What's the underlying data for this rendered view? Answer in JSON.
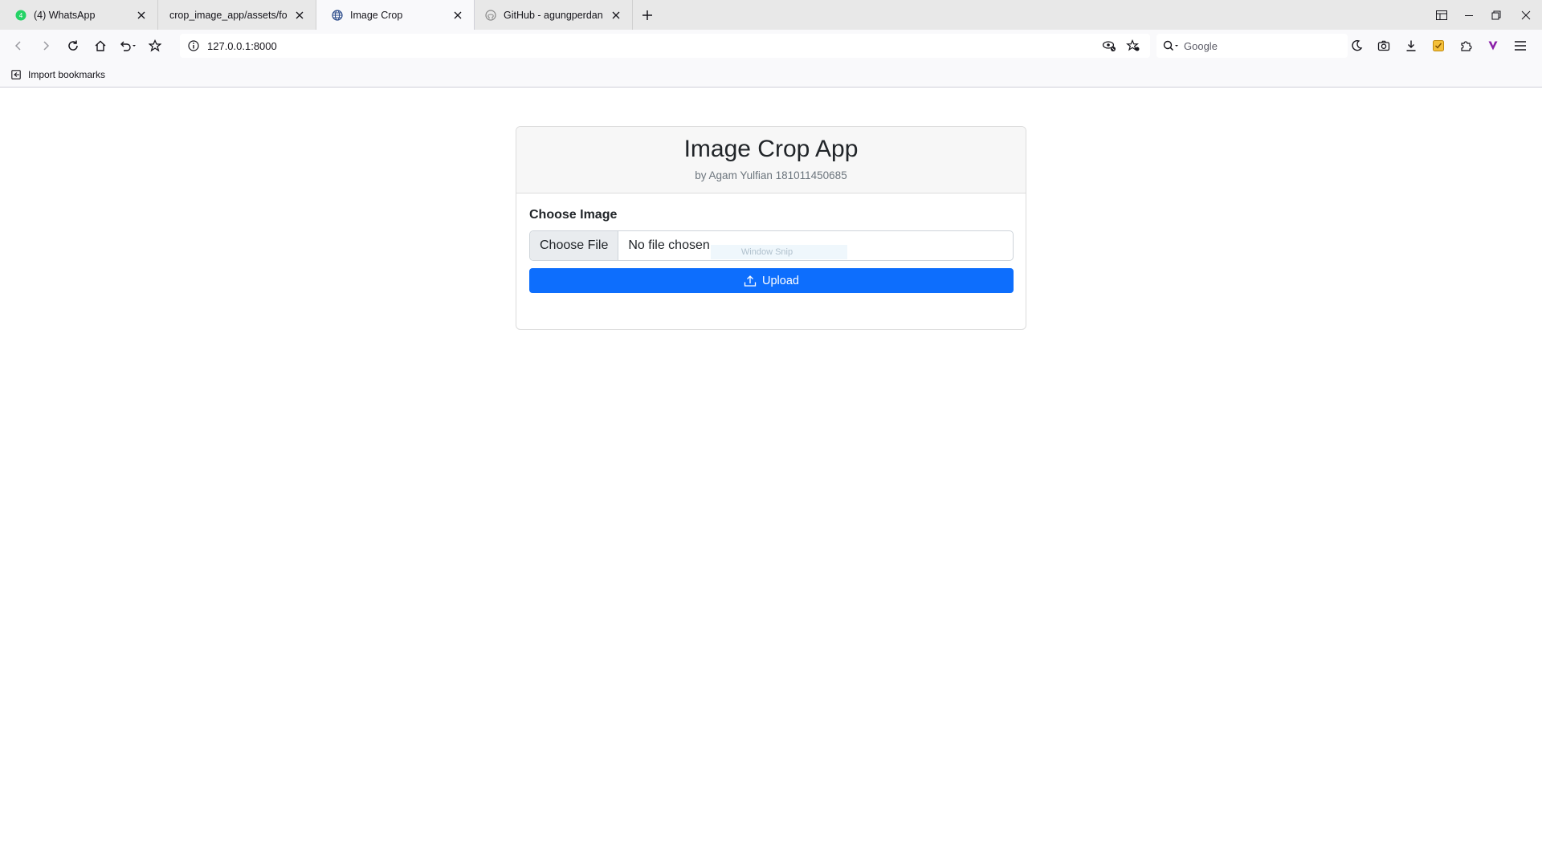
{
  "browser": {
    "tabs": [
      {
        "title": "(4) WhatsApp",
        "icon": "whatsapp-icon",
        "active": false
      },
      {
        "title": "crop_image_app/assets/form.",
        "icon": "",
        "active": false
      },
      {
        "title": "Image Crop",
        "icon": "globe-icon",
        "active": true
      },
      {
        "title": "GitHub - agungperdana",
        "icon": "github-icon",
        "active": false
      }
    ],
    "url": "127.0.0.1:8000",
    "search_placeholder": "Google",
    "bookmarks": [
      {
        "label": "Import bookmarks",
        "icon": "import-icon"
      }
    ]
  },
  "app": {
    "title": "Image Crop App",
    "subtitle": "by Agam Yulfian 181011450685",
    "field_label": "Choose Image",
    "file_button": "Choose File",
    "file_status": "No file chosen",
    "overlay_hint": "Window Snip",
    "upload_label": "Upload",
    "primary_color": "#0d6efd"
  }
}
